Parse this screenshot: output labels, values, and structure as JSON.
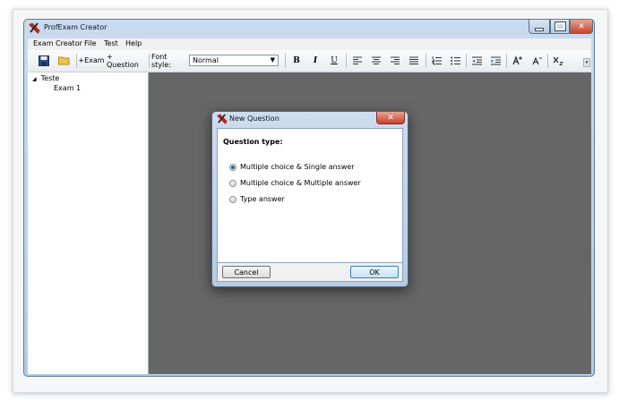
{
  "window": {
    "title": "ProfExam Creator"
  },
  "menu": [
    "Exam Creator",
    "File",
    "Test",
    "Help"
  ],
  "toolbar": {
    "add_exam": "+Exam",
    "add_question": "+ Question",
    "font_style_label": "Font style:",
    "font_style_value": "Normal",
    "bold": "B",
    "italic": "I",
    "underline": "U"
  },
  "tree": {
    "root": "Teste",
    "child": "Exam 1"
  },
  "dialog": {
    "title": "New Question",
    "heading": "Question type:",
    "options": [
      {
        "label": "Multiple choice & Single answer",
        "selected": true
      },
      {
        "label": "Multiple choice & Multiple answer",
        "selected": false
      },
      {
        "label": "Type answer",
        "selected": false
      }
    ],
    "cancel": "Cancel",
    "ok": "OK"
  },
  "colors": {
    "workspace": "#666666",
    "close_button": "#c8412b",
    "titlebar": "#b4cce6"
  }
}
